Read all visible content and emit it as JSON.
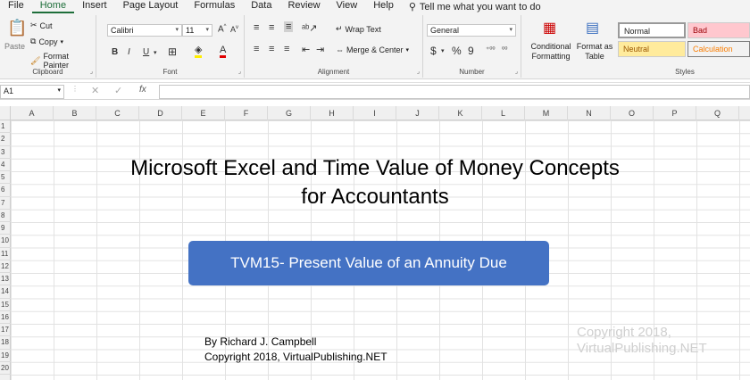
{
  "menu": {
    "items": [
      "File",
      "Home",
      "Insert",
      "Page Layout",
      "Formulas",
      "Data",
      "Review",
      "View",
      "Help"
    ],
    "active": "Home",
    "tell_me": "Tell me what you want to do"
  },
  "ribbon": {
    "clipboard": {
      "paste": "Paste",
      "cut": "Cut",
      "copy": "Copy",
      "format_painter": "Format Painter",
      "label": "Clipboard"
    },
    "font": {
      "family": "Calibri",
      "size": "11",
      "bold": "B",
      "italic": "I",
      "underline": "U",
      "label": "Font"
    },
    "alignment": {
      "wrap": "Wrap Text",
      "merge": "Merge & Center",
      "label": "Alignment"
    },
    "number": {
      "format": "General",
      "currency": "$",
      "percent": "%",
      "comma": "9",
      "label": "Number"
    },
    "styles": {
      "conditional": "Conditional Formatting",
      "format_table": "Format as Table",
      "cells": [
        {
          "name": "Normal",
          "bg": "#ffffff",
          "fg": "#000000"
        },
        {
          "name": "Bad",
          "bg": "#ffc7ce",
          "fg": "#9c0006"
        },
        {
          "name": "Neutral",
          "bg": "#ffeb9c",
          "fg": "#9c5700"
        },
        {
          "name": "Calculation",
          "bg": "#f2f2f2",
          "fg": "#fa7d00"
        }
      ],
      "label": "Styles"
    }
  },
  "formula_bar": {
    "name_box": "A1",
    "fx": "fx",
    "value": ""
  },
  "grid": {
    "columns": [
      "A",
      "B",
      "C",
      "D",
      "E",
      "F",
      "G",
      "H",
      "I",
      "J",
      "K",
      "L",
      "M",
      "N",
      "O",
      "P",
      "Q"
    ],
    "rows": [
      "1",
      "2",
      "3",
      "4",
      "5",
      "6",
      "7",
      "8",
      "9",
      "10",
      "11",
      "12",
      "13",
      "14",
      "15",
      "16",
      "17",
      "18",
      "19",
      "20"
    ]
  },
  "slide": {
    "title_line1": "Microsoft Excel and Time Value of Money Concepts",
    "title_line2": "for Accountants",
    "button_text": "TVM15- Present Value of an Annuity Due",
    "author": "By Richard J. Campbell",
    "copyright": "Copyright 2018, VirtualPublishing.NET",
    "watermark_line1": "Copyright 2018,",
    "watermark_line2": "VirtualPublishing.NET"
  },
  "colors": {
    "accent": "#1e6e3a",
    "button": "#4472c4"
  }
}
